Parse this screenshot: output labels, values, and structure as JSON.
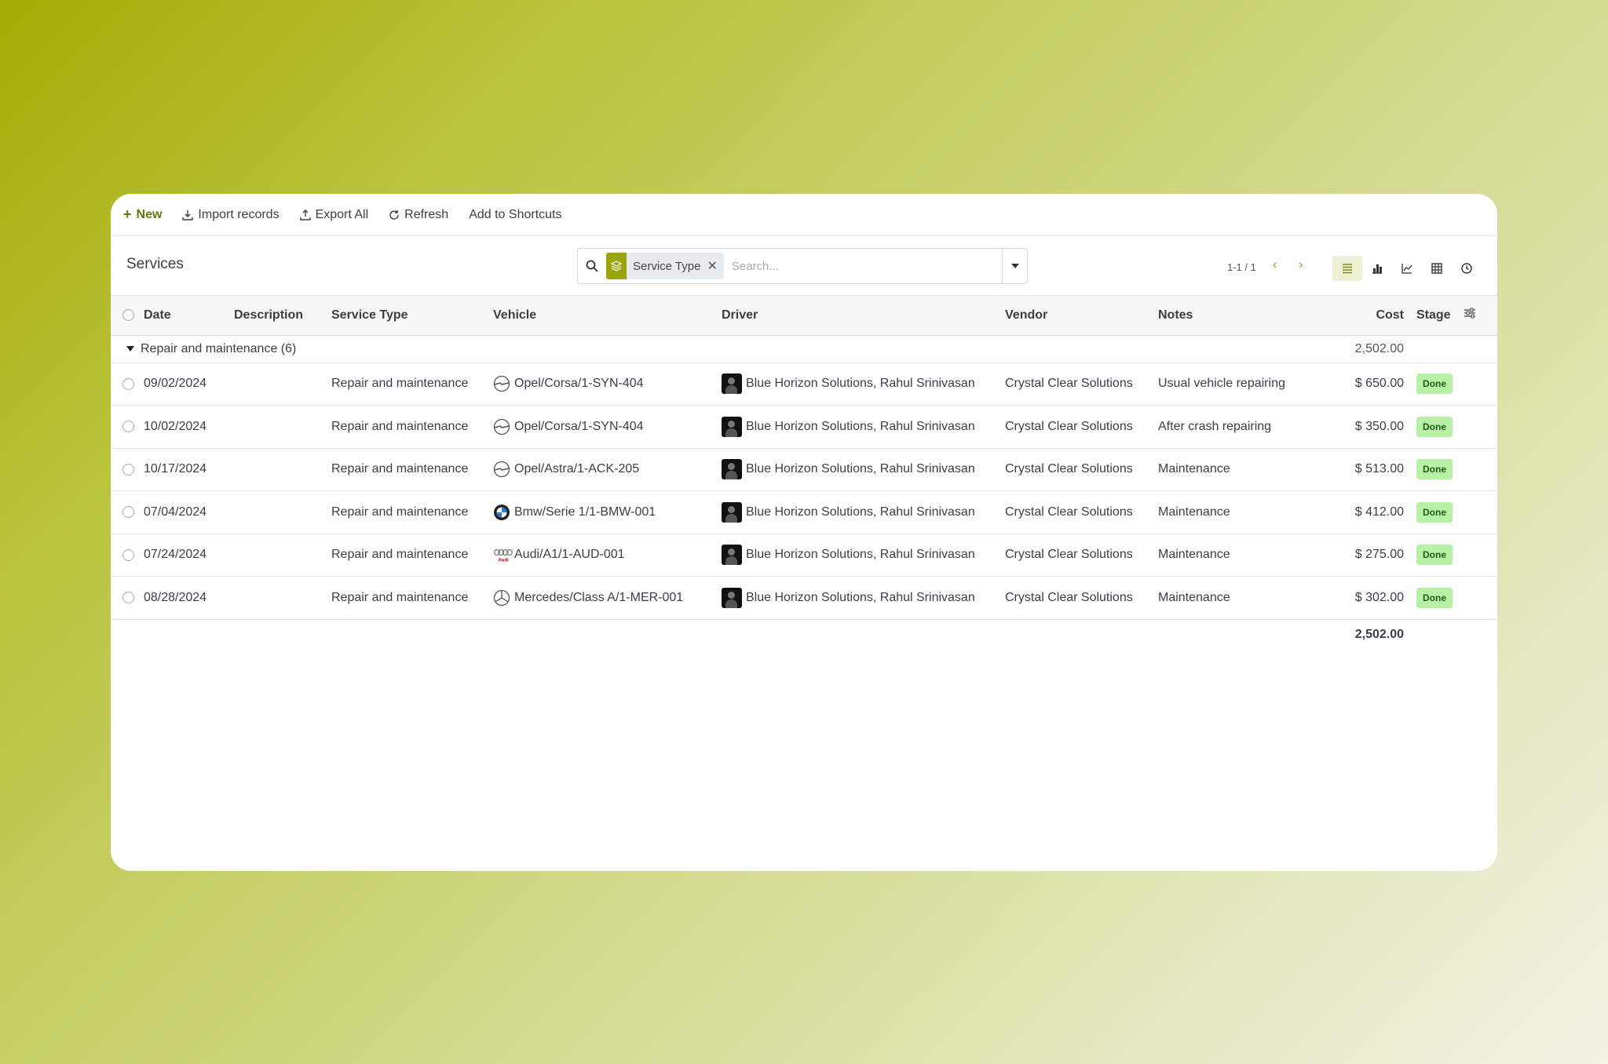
{
  "toolbar": {
    "new_label": "New",
    "import_label": "Import records",
    "export_label": "Export All",
    "refresh_label": "Refresh",
    "shortcuts_label": "Add to Shortcuts"
  },
  "page": {
    "title": "Services"
  },
  "search": {
    "facet_label": "Service Type",
    "placeholder": "Search..."
  },
  "pager": {
    "value": "1-1 / 1"
  },
  "columns": {
    "date": "Date",
    "description": "Description",
    "service_type": "Service Type",
    "vehicle": "Vehicle",
    "driver": "Driver",
    "vendor": "Vendor",
    "notes": "Notes",
    "cost": "Cost",
    "stage": "Stage"
  },
  "group": {
    "label": "Repair and maintenance (6)",
    "total": "2,502.00"
  },
  "rows": [
    {
      "date": "09/02/2024",
      "service_type": "Repair and maintenance",
      "vehicle": "Opel/Corsa/1-SYN-404",
      "vehicle_brand": "opel",
      "driver": "Blue Horizon Solutions, Rahul Srinivasan",
      "vendor": "Crystal Clear Solutions",
      "notes": "Usual vehicle repairing",
      "cost": "$ 650.00",
      "stage": "Done"
    },
    {
      "date": "10/02/2024",
      "service_type": "Repair and maintenance",
      "vehicle": "Opel/Corsa/1-SYN-404",
      "vehicle_brand": "opel",
      "driver": "Blue Horizon Solutions, Rahul Srinivasan",
      "vendor": "Crystal Clear Solutions",
      "notes": "After crash repairing",
      "cost": "$ 350.00",
      "stage": "Done"
    },
    {
      "date": "10/17/2024",
      "service_type": "Repair and maintenance",
      "vehicle": "Opel/Astra/1-ACK-205",
      "vehicle_brand": "opel",
      "driver": "Blue Horizon Solutions, Rahul Srinivasan",
      "vendor": "Crystal Clear Solutions",
      "notes": "Maintenance",
      "cost": "$ 513.00",
      "stage": "Done"
    },
    {
      "date": "07/04/2024",
      "service_type": "Repair and maintenance",
      "vehicle": "Bmw/Serie 1/1-BMW-001",
      "vehicle_brand": "bmw",
      "driver": "Blue Horizon Solutions, Rahul Srinivasan",
      "vendor": "Crystal Clear Solutions",
      "notes": "Maintenance",
      "cost": "$ 412.00",
      "stage": "Done"
    },
    {
      "date": "07/24/2024",
      "service_type": "Repair and maintenance",
      "vehicle": "Audi/A1/1-AUD-001",
      "vehicle_brand": "audi",
      "driver": "Blue Horizon Solutions, Rahul Srinivasan",
      "vendor": "Crystal Clear Solutions",
      "notes": "Maintenance",
      "cost": "$ 275.00",
      "stage": "Done"
    },
    {
      "date": "08/28/2024",
      "service_type": "Repair and maintenance",
      "vehicle": "Mercedes/Class A/1-MER-001",
      "vehicle_brand": "mercedes",
      "driver": "Blue Horizon Solutions, Rahul Srinivasan",
      "vendor": "Crystal Clear Solutions",
      "notes": "Maintenance",
      "cost": "$ 302.00",
      "stage": "Done"
    }
  ],
  "footer": {
    "total": "2,502.00"
  },
  "colors": {
    "accent": "#9aa50e",
    "done_badge": "#b8f0a8"
  },
  "icons": {
    "audi_logo_text": "Audi"
  }
}
